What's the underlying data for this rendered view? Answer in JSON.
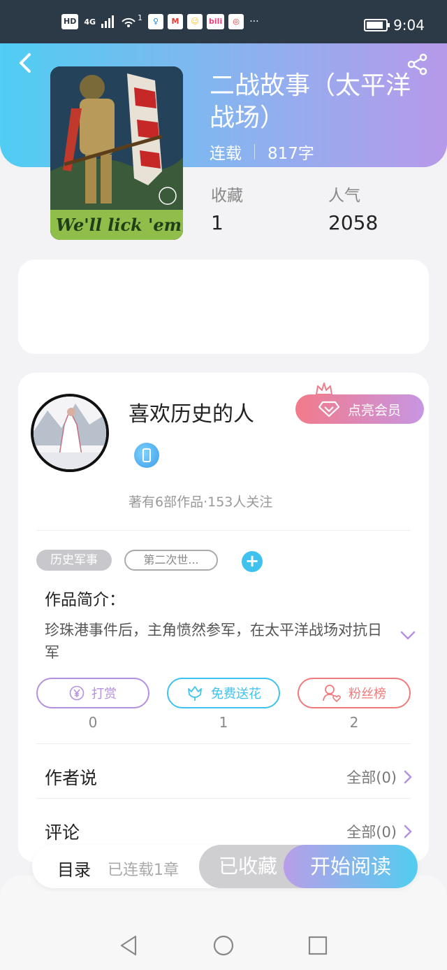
{
  "status_bar": {
    "network": "HD",
    "signal": "4G",
    "wifi_badge": "1",
    "time": "9:04",
    "more": "···",
    "app_chips": [
      {
        "label": "♀",
        "color": "#1e88e5"
      },
      {
        "label": "M",
        "color": "#e53935"
      },
      {
        "label": "☺",
        "color": "#fbc02d"
      },
      {
        "label": "bili",
        "color": "#ec407a"
      },
      {
        "label": "◎",
        "color": "#e53935"
      }
    ],
    "battery_level": 0.9
  },
  "header": {
    "back_icon": "chevron-left-icon",
    "share_icon": "share-icon",
    "title": "二战故事（太平洋战场）",
    "status": "连载",
    "word_count": "817字",
    "cover_caption": "We'll lick 'em"
  },
  "stats": {
    "favorites_label": "收藏",
    "favorites_value": "1",
    "popularity_label": "人气",
    "popularity_value": "2058"
  },
  "author": {
    "name": "喜欢历史的人",
    "vip_label": "点亮会员",
    "summary": "著有6部作品·153人关注"
  },
  "tags": {
    "filled": "历史军事",
    "outline": "第二次世...",
    "add": "+"
  },
  "intro": {
    "label": "作品简介：",
    "text": "珍珠港事件后，主角愤然参军，在太平洋战场对抗日军"
  },
  "actions": [
    {
      "label": "打赏",
      "count": "0",
      "color": "#b491e0"
    },
    {
      "label": "免费送花",
      "count": "1",
      "color": "#3fc3ee"
    },
    {
      "label": "粉丝榜",
      "count": "2",
      "color": "#f07a7a"
    }
  ],
  "sections": {
    "author_says_label": "作者说",
    "author_says_link": "全部(0)",
    "comments_label": "评论",
    "comments_link": "全部(0)"
  },
  "reader_bar": {
    "toc_label": "目录",
    "toc_status": "已连载1章",
    "favorited_label": "已收藏",
    "start_reading_label": "开始阅读"
  },
  "colors": {
    "accent_blue": "#4fcdf2",
    "accent_purple": "#b799ea"
  }
}
